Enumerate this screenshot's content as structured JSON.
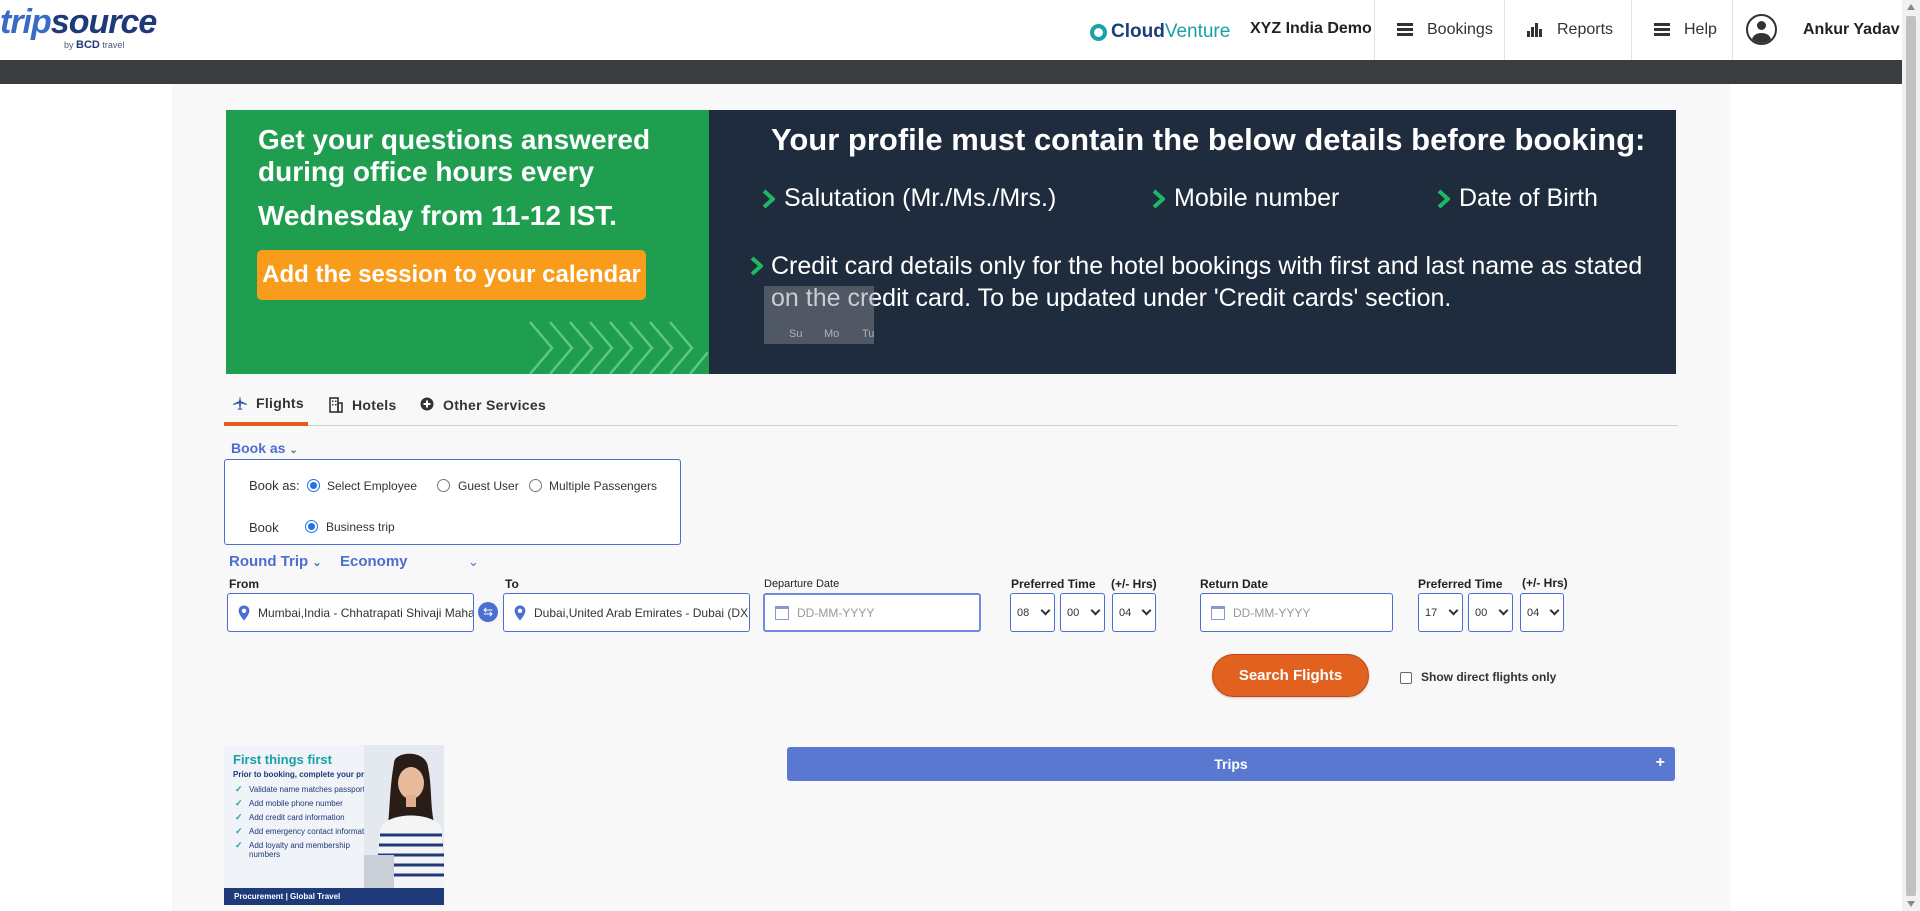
{
  "header": {
    "logo_trip": "trip",
    "logo_source": "source",
    "logo_by": "by",
    "logo_bcd": "BCD",
    "logo_travel": "travel",
    "partner_cloud": "Cloud",
    "partner_venture": "Venture",
    "company": "XYZ India Demo",
    "nav": [
      {
        "label": "Bookings",
        "icon": "hamburger-icon"
      },
      {
        "label": "Reports",
        "icon": "bar-chart-icon"
      },
      {
        "label": "Help",
        "icon": "hamburger-icon"
      }
    ],
    "user_name": "Ankur Yadav"
  },
  "banner": {
    "question": "Get your questions answered during office hours every",
    "question2": "Wednesday from 11-12 IST.",
    "cta": "Add the session to your calendar",
    "title": "Your profile must contain the below details before booking:",
    "items": [
      "Salutation (Mr./Ms./Mrs.)",
      "Mobile number",
      "Date of Birth"
    ],
    "credit_card_note": "Credit card details only for the hotel bookings with first and last name as stated on the credit card. To be updated under 'Credit cards' section.",
    "calendar_days": [
      "Su",
      "Mo",
      "Tu"
    ]
  },
  "tabs": [
    {
      "label": "Flights",
      "active": true
    },
    {
      "label": "Hotels",
      "active": false
    },
    {
      "label": "Other Services",
      "active": false
    }
  ],
  "book_as": {
    "toggle_label": "Book as",
    "row1_label": "Book as:",
    "options": [
      "Select Employee",
      "Guest User",
      "Multiple Passengers"
    ],
    "selected": "Select Employee",
    "row2_label": "Book",
    "trip_option": "Business trip"
  },
  "search": {
    "trip_type": "Round Trip",
    "cabin_class": "Economy",
    "from_label": "From",
    "from_value": "Mumbai,India - Chhatrapati Shivaji Maharaj International Airport (BOM)",
    "to_label": "To",
    "to_value": "Dubai,United Arab Emirates - Dubai  (DXB)",
    "departure_label": "Departure Date",
    "departure_placeholder": "DD-MM-YYYY",
    "dep_pref_time_label": "Preferred Time",
    "dep_hrs_label": "(+/- Hrs)",
    "dep_hour": "08",
    "dep_min": "00",
    "dep_window": "04",
    "return_label": "Return Date",
    "return_placeholder": "DD-MM-YYYY",
    "ret_pref_time_label": "Preferred Time",
    "ret_hrs_label": "(+/- Hrs)",
    "ret_hour": "17",
    "ret_min": "00",
    "ret_window": "04",
    "search_button": "Search Flights",
    "direct_only_label": "Show direct flights only"
  },
  "promo": {
    "title": "First things first",
    "subtitle": "Prior to booking, complete your profile:",
    "items": [
      "Validate name matches passport",
      "Add mobile phone number",
      "Add credit card information",
      "Add emergency contact information",
      "Add loyalty and membership numbers"
    ],
    "footer": "Procurement | Global Travel"
  },
  "trips": {
    "label": "Trips",
    "toggle": "+"
  },
  "colors": {
    "accent_blue": "#4d6ed1",
    "search_orange": "#e3611f",
    "banner_green": "#1f9e4f",
    "banner_dark": "#1f2c3d",
    "cta_orange": "#f99c1c"
  }
}
